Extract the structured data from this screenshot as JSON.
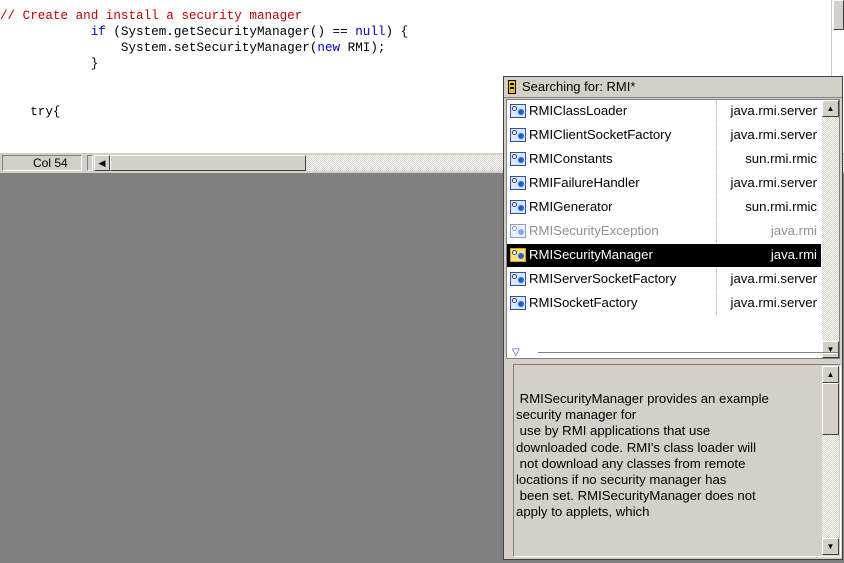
{
  "editor": {
    "lines": [
      {
        "segments": [
          {
            "text": "// Create and install a security manager",
            "style": "comment"
          }
        ]
      },
      {
        "segments": [
          {
            "text": "            ",
            "style": "plain"
          },
          {
            "text": "if",
            "style": "kw"
          },
          {
            "text": " (System.getSecurityManager() == ",
            "style": "plain"
          },
          {
            "text": "null",
            "style": "kw"
          },
          {
            "text": ") {",
            "style": "plain"
          }
        ]
      },
      {
        "segments": [
          {
            "text": "                System.setSecurityManager(",
            "style": "plain"
          },
          {
            "text": "new",
            "style": "kw"
          },
          {
            "text": " RMI);",
            "style": "plain"
          }
        ]
      },
      {
        "segments": [
          {
            "text": "            }",
            "style": "plain"
          }
        ]
      },
      {
        "segments": []
      },
      {
        "segments": []
      },
      {
        "segments": [
          {
            "text": "    try{",
            "style": "plain"
          }
        ]
      }
    ]
  },
  "statusbar": {
    "col_label": "Col 54"
  },
  "popup": {
    "title": "Searching for: RMI*",
    "items": [
      {
        "name": "RMIClassLoader",
        "package": "java.rmi.server",
        "state": "normal",
        "icon": "class-icon"
      },
      {
        "name": "RMIClientSocketFactory",
        "package": "java.rmi.server",
        "state": "normal",
        "icon": "class-icon"
      },
      {
        "name": "RMIConstants",
        "package": "sun.rmi.rmic",
        "state": "normal",
        "icon": "class-icon"
      },
      {
        "name": "RMIFailureHandler",
        "package": "java.rmi.server",
        "state": "normal",
        "icon": "class-icon"
      },
      {
        "name": "RMIGenerator",
        "package": "sun.rmi.rmic",
        "state": "normal",
        "icon": "class-icon"
      },
      {
        "name": "RMISecurityException",
        "package": "java.rmi",
        "state": "dim",
        "icon": "class-icon"
      },
      {
        "name": "RMISecurityManager",
        "package": "java.rmi",
        "state": "selected",
        "icon": "class-icon"
      },
      {
        "name": "RMIServerSocketFactory",
        "package": "java.rmi.server",
        "state": "normal",
        "icon": "class-icon"
      },
      {
        "name": "RMISocketFactory",
        "package": "java.rmi.server",
        "state": "normal",
        "icon": "class-icon"
      }
    ],
    "doc_text": " RMISecurityManager provides an example\nsecurity manager for\n use by RMI applications that use\ndownloaded code. RMI's class loader will\n not download any classes from remote\nlocations if no security manager has\n been set. RMISecurityManager does not\napply to applets, which"
  },
  "colors": {
    "comment": "#c00000",
    "keyword": "#0000c0",
    "selection": "#000000",
    "background_area": "#808080"
  }
}
